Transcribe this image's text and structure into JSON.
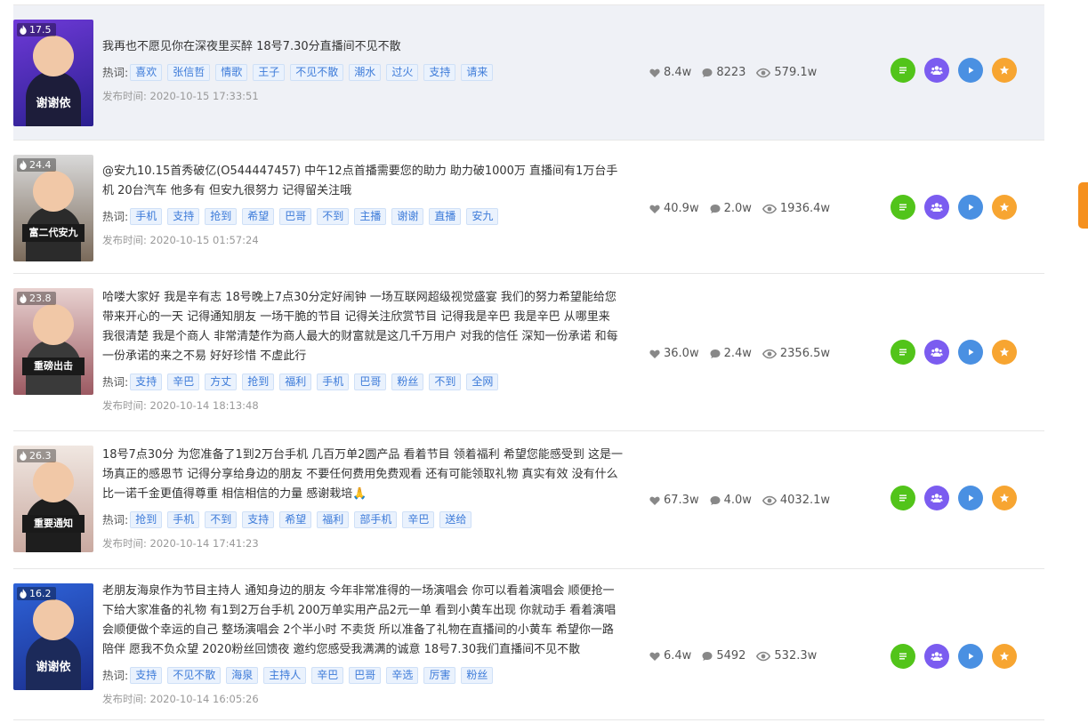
{
  "tags_label": "热词:",
  "pub_label": "发布时间:",
  "colors": {
    "like": "#888888",
    "green": "#52c41a",
    "purple": "#7b5cf0",
    "blue": "#4a90e2",
    "orange": "#f7a531",
    "scroll": "#f5901e"
  },
  "items": [
    {
      "heat": "17.5",
      "thumb_caption": "谢谢依",
      "desc": "我再也不愿见你在深夜里买醉 18号7.30分直播间不见不散",
      "tags": [
        "喜欢",
        "张信哲",
        "情歌",
        "王子",
        "不见不散",
        "潮水",
        "过火",
        "支持",
        "请来"
      ],
      "pub_time": "2020-10-15 17:33:51",
      "likes": "8.4w",
      "comments": "8223",
      "views": "579.1w"
    },
    {
      "heat": "24.4",
      "thumb_caption": "富二代安九",
      "desc": "@安九10.15首秀破亿(O544447457) 中午12点首播需要您的助力 助力破1000万 直播间有1万台手机 20台汽车 他多有 但安九很努力 记得留关注哦",
      "tags": [
        "手机",
        "支持",
        "抢到",
        "希望",
        "巴哥",
        "不到",
        "主播",
        "谢谢",
        "直播",
        "安九"
      ],
      "pub_time": "2020-10-15 01:57:24",
      "likes": "40.9w",
      "comments": "2.0w",
      "views": "1936.4w"
    },
    {
      "heat": "23.8",
      "thumb_caption": "重磅出击",
      "desc": "哈喽大家好 我是辛有志 18号晚上7点30分定好闹钟 一场互联网超级视觉盛宴 我们的努力希望能给您带来开心的一天 记得通知朋友 一场干脆的节目 记得关注欣赏节目 记得我是辛巴 我是辛巴 从哪里来 我很清楚 我是个商人 非常清楚作为商人最大的财富就是这几千万用户 对我的信任 深知一份承诺 和每一份承诺的来之不易 好好珍惜 不虚此行",
      "tags": [
        "支持",
        "辛巴",
        "方丈",
        "抢到",
        "福利",
        "手机",
        "巴哥",
        "粉丝",
        "不到",
        "全网"
      ],
      "pub_time": "2020-10-14 18:13:48",
      "likes": "36.0w",
      "comments": "2.4w",
      "views": "2356.5w"
    },
    {
      "heat": "26.3",
      "thumb_caption": "重要通知",
      "desc": "18号7点30分 为您准备了1到2万台手机 几百万单2圆产品 看着节目 领着福利 希望您能感受到 这是一场真正的感恩节 记得分享给身边的朋友 不要任何费用免费观看 还有可能领取礼物 真实有效 没有什么比一诺千金更值得尊重 相信相信的力量 感谢栽培🙏",
      "tags": [
        "抢到",
        "手机",
        "不到",
        "支持",
        "希望",
        "福利",
        "部手机",
        "辛巴",
        "送给"
      ],
      "pub_time": "2020-10-14 17:41:23",
      "likes": "67.3w",
      "comments": "4.0w",
      "views": "4032.1w"
    },
    {
      "heat": "16.2",
      "thumb_caption": "谢谢依",
      "desc": "老朋友海泉作为节目主持人 通知身边的朋友 今年非常准得的一场演唱会 你可以看着演唱会 顺便抢一下给大家准备的礼物 有1到2万台手机 200万单实用产品2元一单 看到小黄车出现 你就动手 看着演唱会顺便做个幸运的自己 整场演唱会 2个半小时 不卖货 所以准备了礼物在直播间的小黄车 希望你一路陪伴 愿我不负众望 2020粉丝回馈夜 邀约您感受我满满的诚意 18号7.30我们直播间不见不散",
      "tags": [
        "支持",
        "不见不散",
        "海泉",
        "主持人",
        "辛巴",
        "巴哥",
        "辛选",
        "厉害",
        "粉丝"
      ],
      "pub_time": "2020-10-14 16:05:26",
      "likes": "6.4w",
      "comments": "5492",
      "views": "532.3w"
    }
  ]
}
